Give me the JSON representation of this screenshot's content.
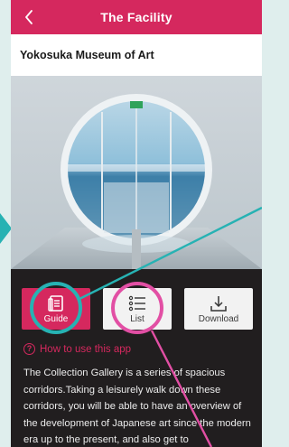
{
  "header": {
    "title": "The Facility",
    "back_icon": "chevron-left-icon"
  },
  "facility": {
    "name": "Yokosuka Museum of Art"
  },
  "actions": {
    "guide_label": "Guide",
    "list_label": "List",
    "download_label": "Download"
  },
  "help": {
    "icon_text": "?",
    "link_text": "How to use this app"
  },
  "description": {
    "text": "The Collection Gallery is a series of spacious corridors.Taking a leisurely walk down these corridors, you will be able to have an overview of the development of Japanese art since the modern era up to the present, and also get to"
  },
  "colors": {
    "accent": "#d5285e",
    "annotation_teal": "#27b2b3",
    "annotation_pink": "#e24fa4",
    "dark_background": "#211e1f"
  },
  "icons": {
    "guide": "guide-book-icon",
    "list": "list-icon",
    "download": "download-icon",
    "help": "question-circle-icon"
  }
}
